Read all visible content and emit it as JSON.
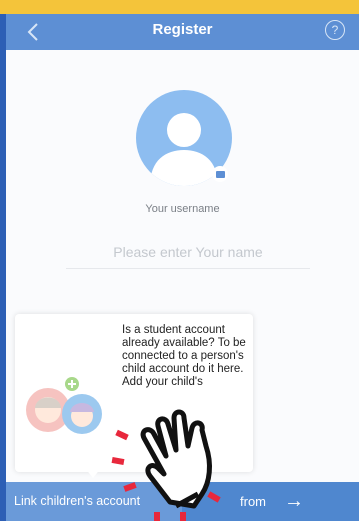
{
  "header": {
    "back_icon": "chevron-left-icon",
    "title": "Register",
    "help_icon": "question-circle-icon",
    "help_symbol": "?"
  },
  "profile": {
    "avatar_icon": "user-silhouette-icon",
    "camera_icon": "camera-icon",
    "username_label": "Your username",
    "name_placeholder": "Please enter Your name"
  },
  "popup": {
    "text": "Is a student account already available? To be connected to a person's child account do it here. Add your child's",
    "illustration_icon": "children-avatars-icon"
  },
  "bottom_bar": {
    "link_label": "Link children's account",
    "from_label": "from",
    "arrow_icon": "arrow-right-icon",
    "arrow_symbol": "→"
  },
  "overlay": {
    "hand_icon": "tap-hand-icon"
  },
  "colors": {
    "top_strip": "#f4c43a",
    "navbar": "#5d8fd4",
    "avatar": "#8dbdf0",
    "bottom_bar": "#4f87cf",
    "bottom_left": "#6a9ad9",
    "tap_marks": "#e8283c"
  }
}
